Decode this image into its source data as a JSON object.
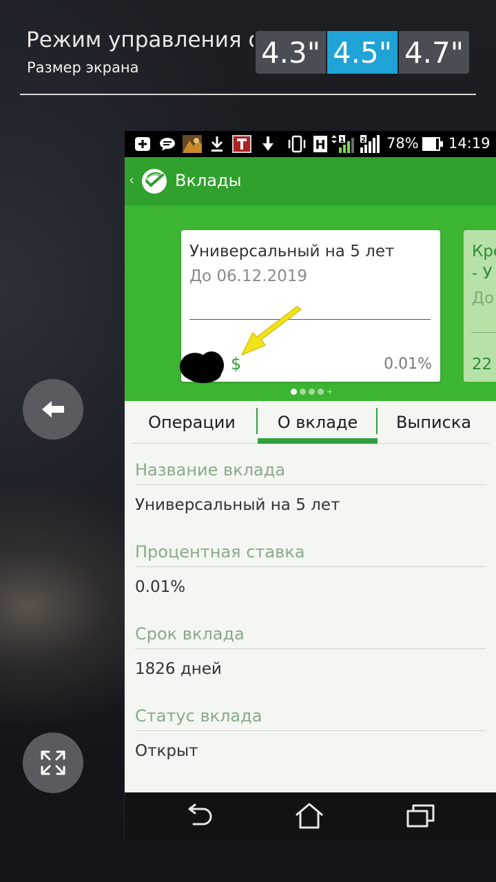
{
  "one_hand_mode": {
    "title": "Режим управления о...",
    "subtitle": "Размер экрана",
    "sizes": [
      {
        "label": "4.3\"",
        "active": false
      },
      {
        "label": "4.5\"",
        "active": true
      },
      {
        "label": "4.7\"",
        "active": false
      }
    ],
    "active_color": "#1fa2d6"
  },
  "side_controls": {
    "back_icon": "arrow-left-icon",
    "expand_icon": "expand-icon"
  },
  "status_bar": {
    "network": "H",
    "sim1": "1",
    "sim2": "2",
    "battery": "78%",
    "time": "14:19"
  },
  "app": {
    "title": "Вклады",
    "brand_color": "#2fa12c",
    "logo_icon": "sberbank-logo-icon"
  },
  "deposit_card": {
    "title": "Универсальный на 5 лет",
    "date": "До 06.12.2019",
    "currency": "$",
    "rate": "0.01%"
  },
  "next_card": {
    "line1": "Кре",
    "line2": "- У",
    "line3": "До",
    "line4": "22"
  },
  "pager": {
    "total": 4,
    "current": 1,
    "plus": "+"
  },
  "tabs": [
    {
      "label": "Операции",
      "active": false
    },
    {
      "label": "О вкладе",
      "active": true
    },
    {
      "label": "Выписка",
      "active": false
    }
  ],
  "details": [
    {
      "label": "Название вклада",
      "value": "Универсальный на 5 лет"
    },
    {
      "label": "Процентная ставка",
      "value": "0.01%"
    },
    {
      "label": "Срок вклада",
      "value": "1826 дней"
    },
    {
      "label": "Статус вклада",
      "value": "Открыт"
    }
  ],
  "nav": {
    "back_icon": "back-icon",
    "home_icon": "home-icon",
    "recents_icon": "recents-icon"
  }
}
